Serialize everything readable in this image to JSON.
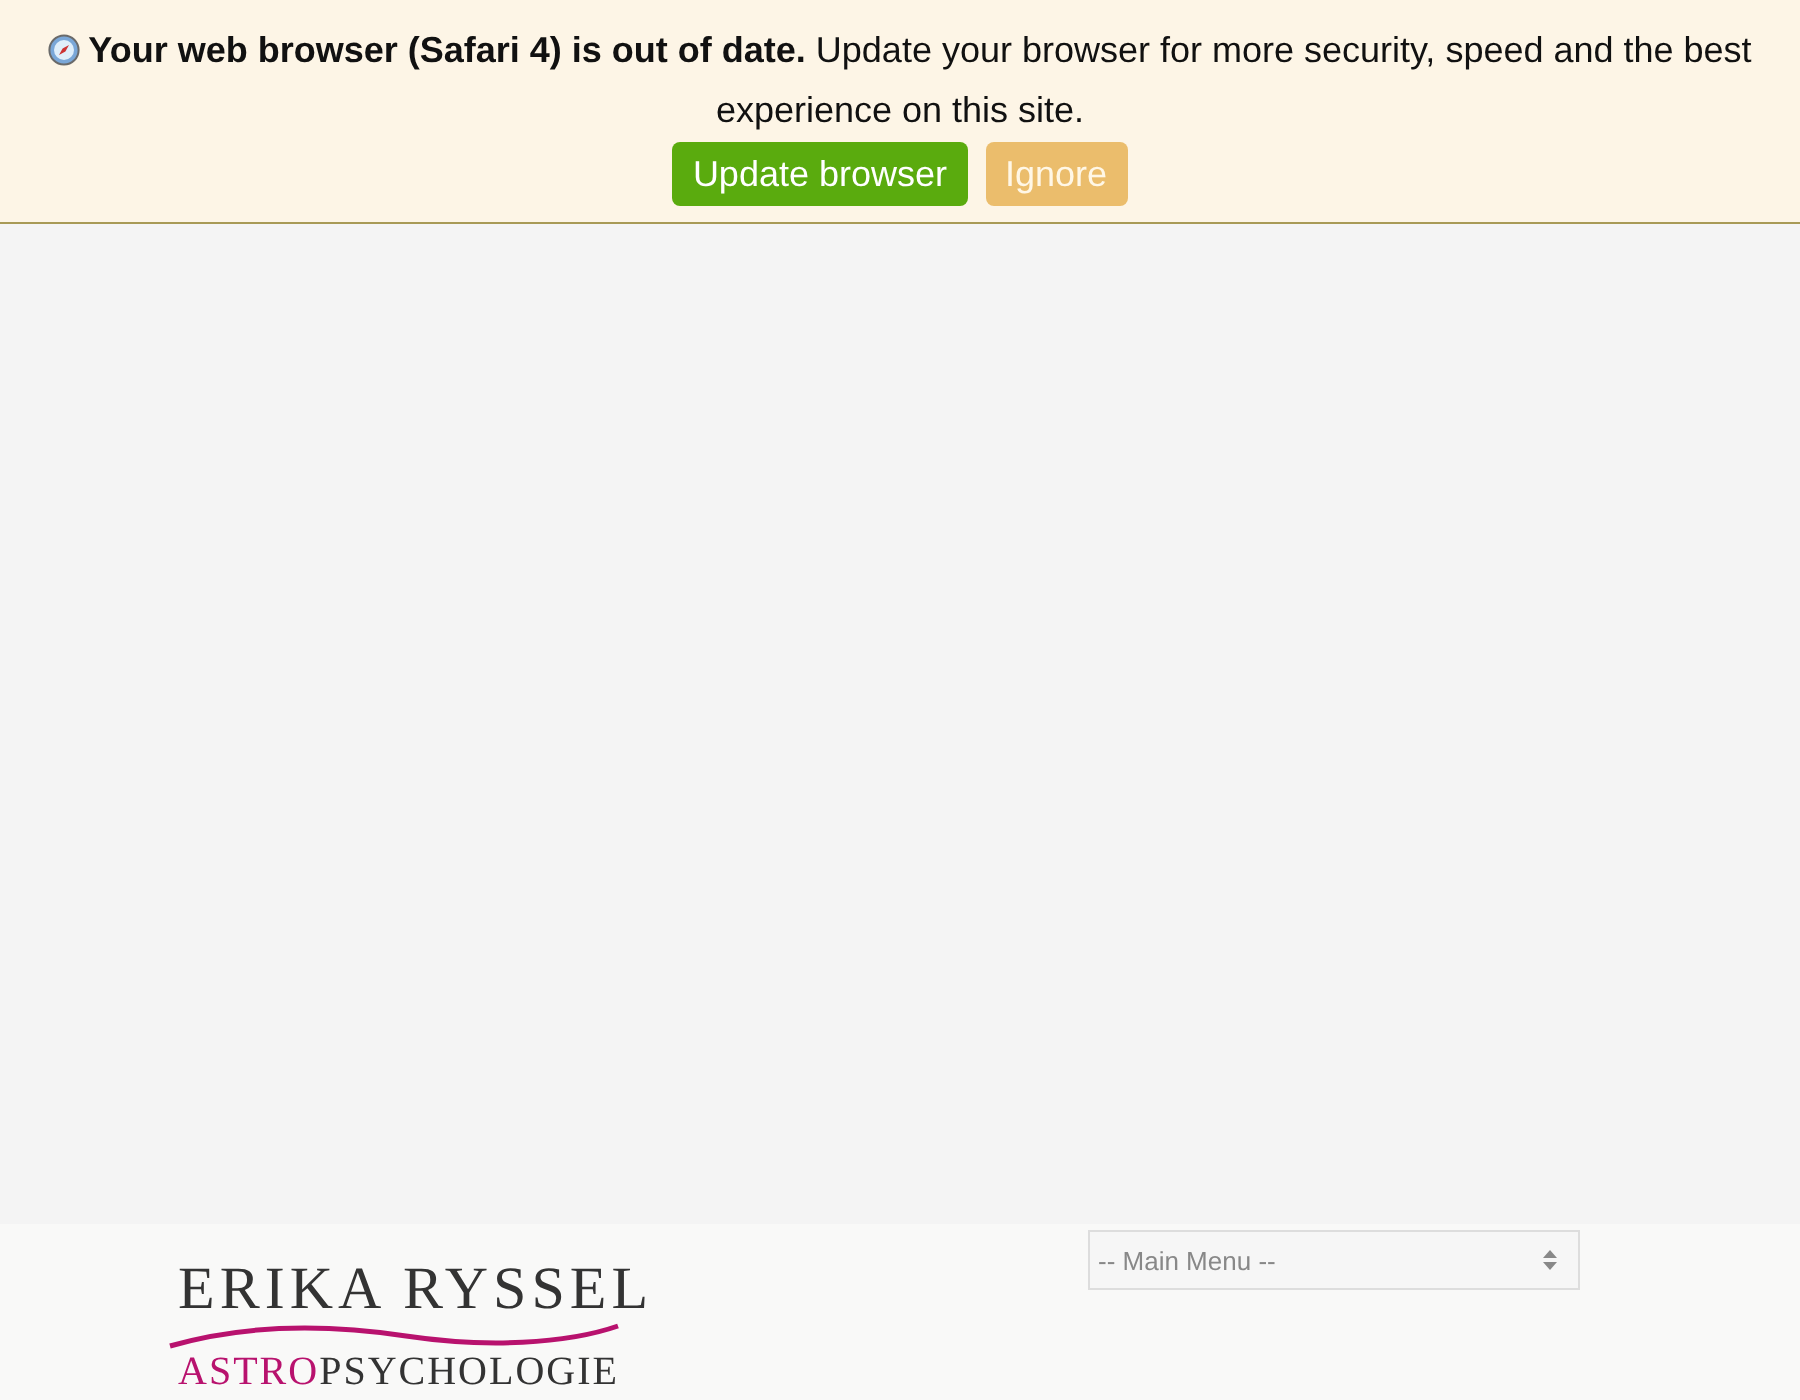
{
  "notice": {
    "message": "**Your web browser (Safari 4) is out of date.** Update your browser for more security, speed and the best experience on this site.",
    "buttons": [
      {
        "label": "Update browser",
        "kind": "primary"
      },
      {
        "label": "Ignore",
        "kind": "secondary"
      }
    ]
  },
  "footer": {
    "logo": {
      "name": "ERIKA RYSSEL",
      "tagline_accent": "ASTRO",
      "tagline_rest": "PSYCHOLOGIE"
    },
    "menu": {
      "placeholder": "-- Main Menu --"
    }
  }
}
